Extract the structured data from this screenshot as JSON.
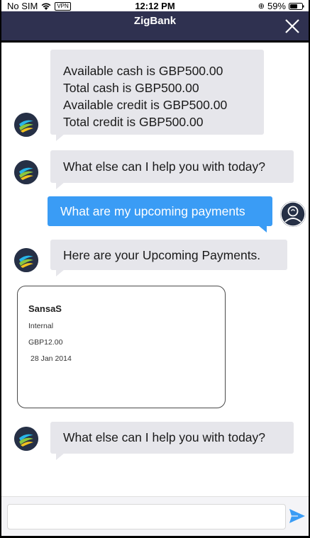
{
  "status_bar": {
    "carrier": "No SIM",
    "vpn": "VPN",
    "time": "12:12 PM",
    "battery": "59%"
  },
  "header": {
    "title": "ZigBank",
    "background_color": "#2f3150",
    "close_icon": "close-icon"
  },
  "messages": [
    {
      "sender": "bot",
      "lines": [
        "Available cash is GBP500.00",
        "Total cash is GBP500.00",
        "Available credit is GBP500.00",
        "Total credit is GBP500.00"
      ]
    },
    {
      "sender": "bot",
      "lines": [
        "What else can I help you with today?"
      ]
    },
    {
      "sender": "user",
      "lines": [
        "What are my upcoming payments"
      ]
    },
    {
      "sender": "bot",
      "lines": [
        "Here are your Upcoming Payments."
      ]
    },
    {
      "sender": "bot",
      "lines": [
        "What else can I help you with today?"
      ]
    }
  ],
  "payment_card": {
    "name": "SansaS",
    "type": "Internal",
    "amount": "GBP12.00",
    "date": "28 Jan 2014"
  },
  "input": {
    "placeholder": "",
    "value": "",
    "send_icon": "send-icon"
  },
  "colors": {
    "bot_bubble": "#e6e6eb",
    "user_bubble": "#3a9cf5",
    "accent": "#3a9cf5"
  }
}
